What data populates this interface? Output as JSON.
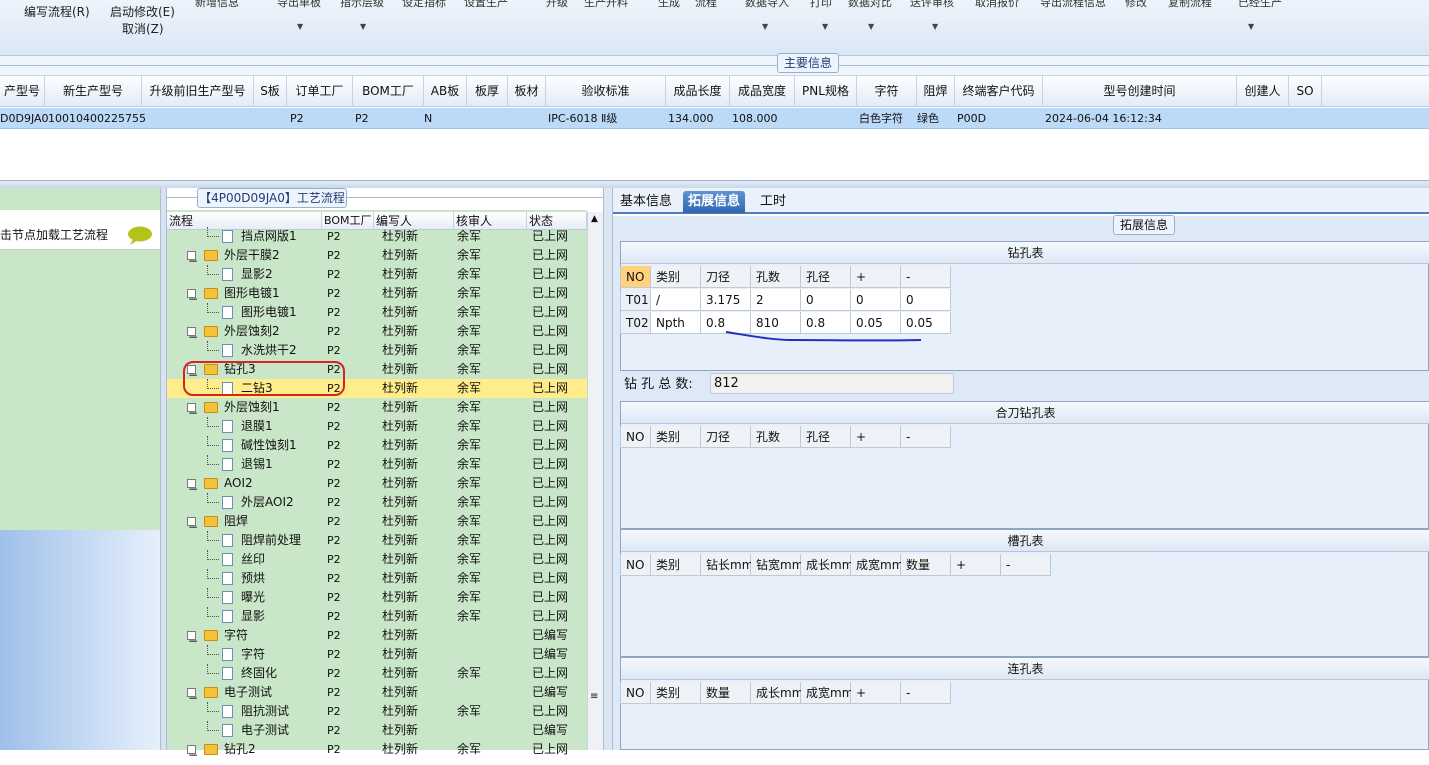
{
  "toolbar": {
    "edit_flow": "编写流程(R)",
    "start_modify": "启动修改(E)",
    "cancel": "取消(Z)",
    "cut_labels": [
      "新增信息",
      "导出单板",
      "指示层级",
      "设定指标",
      "设置生产",
      "升级",
      "生产开料",
      "生成",
      "流程",
      "数据导入",
      "打印",
      "数据对比",
      "送评审核",
      "取消报价",
      "导出流程信息",
      "修改",
      "复制流程",
      "已经生产"
    ]
  },
  "main_info": {
    "group_title": "主要信息",
    "columns": [
      "产型号",
      "新生产型号",
      "升级前旧生产型号",
      "S板",
      "订单工厂",
      "BOM工厂",
      "AB板",
      "板厚",
      "板材",
      "验收标准",
      "成品长度",
      "成品宽度",
      "PNL规格",
      "字符",
      "阻焊",
      "终端客户代码",
      "型号创建时间",
      "创建人",
      "SO"
    ],
    "row": [
      "D0D9JA0",
      "10010400225755",
      "",
      "",
      "P2",
      "P2",
      "N",
      "",
      "",
      "IPC-6018 Ⅱ级",
      "134.000",
      "108.000",
      "",
      "白色字符",
      "绿色",
      "P00D",
      "2024-06-04 16:12:34",
      "",
      ""
    ]
  },
  "left_panel": {
    "caption": "击节点加载工艺流程"
  },
  "process": {
    "title": "【4P00D09JA0】工艺流程",
    "columns": [
      "流程",
      "BOM工厂",
      "编写人",
      "核审人",
      "状态"
    ],
    "rows": [
      {
        "name": "挡点网版1",
        "bom": "P2",
        "writer": "杜列新",
        "checker": "余军",
        "status": "已上网"
      },
      {
        "name": "外层干膜2",
        "bom": "P2",
        "writer": "杜列新",
        "checker": "余军",
        "status": "已上网"
      },
      {
        "name": "显影2",
        "bom": "P2",
        "writer": "杜列新",
        "checker": "余军",
        "status": "已上网"
      },
      {
        "name": "图形电镀1",
        "bom": "P2",
        "writer": "杜列新",
        "checker": "余军",
        "status": "已上网"
      },
      {
        "name": "图形电镀1",
        "bom": "P2",
        "writer": "杜列新",
        "checker": "余军",
        "status": "已上网"
      },
      {
        "name": "外层蚀刻2",
        "bom": "P2",
        "writer": "杜列新",
        "checker": "余军",
        "status": "已上网"
      },
      {
        "name": "水洗烘干2",
        "bom": "P2",
        "writer": "杜列新",
        "checker": "余军",
        "status": "已上网"
      },
      {
        "name": "钻孔3",
        "bom": "P2",
        "writer": "杜列新",
        "checker": "余军",
        "status": "已上网"
      },
      {
        "name": "二钻3",
        "bom": "P2",
        "writer": "杜列新",
        "checker": "余军",
        "status": "已上网"
      },
      {
        "name": "外层蚀刻1",
        "bom": "P2",
        "writer": "杜列新",
        "checker": "余军",
        "status": "已上网"
      },
      {
        "name": "退膜1",
        "bom": "P2",
        "writer": "杜列新",
        "checker": "余军",
        "status": "已上网"
      },
      {
        "name": "碱性蚀刻1",
        "bom": "P2",
        "writer": "杜列新",
        "checker": "余军",
        "status": "已上网"
      },
      {
        "name": "退锡1",
        "bom": "P2",
        "writer": "杜列新",
        "checker": "余军",
        "status": "已上网"
      },
      {
        "name": "AOI2",
        "bom": "P2",
        "writer": "杜列新",
        "checker": "余军",
        "status": "已上网"
      },
      {
        "name": "外层AOI2",
        "bom": "P2",
        "writer": "杜列新",
        "checker": "余军",
        "status": "已上网"
      },
      {
        "name": "阻焊",
        "bom": "P2",
        "writer": "杜列新",
        "checker": "余军",
        "status": "已上网"
      },
      {
        "name": "阻焊前处理",
        "bom": "P2",
        "writer": "杜列新",
        "checker": "余军",
        "status": "已上网"
      },
      {
        "name": "丝印",
        "bom": "P2",
        "writer": "杜列新",
        "checker": "余军",
        "status": "已上网"
      },
      {
        "name": "预烘",
        "bom": "P2",
        "writer": "杜列新",
        "checker": "余军",
        "status": "已上网"
      },
      {
        "name": "曝光",
        "bom": "P2",
        "writer": "杜列新",
        "checker": "余军",
        "status": "已上网"
      },
      {
        "name": "显影",
        "bom": "P2",
        "writer": "杜列新",
        "checker": "余军",
        "status": "已上网"
      },
      {
        "name": "字符",
        "bom": "P2",
        "writer": "杜列新",
        "checker": "",
        "status": "已编写"
      },
      {
        "name": "字符",
        "bom": "P2",
        "writer": "杜列新",
        "checker": "",
        "status": "已编写"
      },
      {
        "name": "终固化",
        "bom": "P2",
        "writer": "杜列新",
        "checker": "余军",
        "status": "已上网"
      },
      {
        "name": "电子测试",
        "bom": "P2",
        "writer": "杜列新",
        "checker": "",
        "status": "已编写"
      },
      {
        "name": "阻抗测试",
        "bom": "P2",
        "writer": "杜列新",
        "checker": "余军",
        "status": "已上网"
      },
      {
        "name": "电子测试",
        "bom": "P2",
        "writer": "杜列新",
        "checker": "",
        "status": "已编写"
      },
      {
        "name": "钻孔2",
        "bom": "P2",
        "writer": "杜列新",
        "checker": "余军",
        "status": "已上网"
      }
    ]
  },
  "right_panel": {
    "tabs": [
      "基本信息",
      "拓展信息",
      "工时"
    ],
    "ext_title": "拓展信息",
    "drill": {
      "title": "钻孔表",
      "columns": [
        "NO",
        "类别",
        "刀径",
        "孔数",
        "孔径",
        "+",
        "-"
      ],
      "rows": [
        [
          "T01",
          "/",
          "3.175",
          "2",
          "0",
          "0",
          "0"
        ],
        [
          "T02",
          "Npth",
          "0.8",
          "810",
          "0.8",
          "0.05",
          "0.05"
        ]
      ]
    },
    "total_label": "钻 孔 总 数:",
    "total_value": "812",
    "combo": {
      "title": "合刀钻孔表",
      "columns": [
        "NO",
        "类别",
        "刀径",
        "孔数",
        "孔径",
        "+",
        "-"
      ]
    },
    "slot": {
      "title": "槽孔表",
      "columns": [
        "NO",
        "类别",
        "钻长mm",
        "钻宽mm",
        "成长mm",
        "成宽mm",
        "数量",
        "+",
        "-"
      ]
    },
    "link": {
      "title": "连孔表",
      "columns": [
        "NO",
        "类别",
        "数量",
        "成长mm",
        "成宽mm",
        "+",
        "-"
      ]
    }
  }
}
